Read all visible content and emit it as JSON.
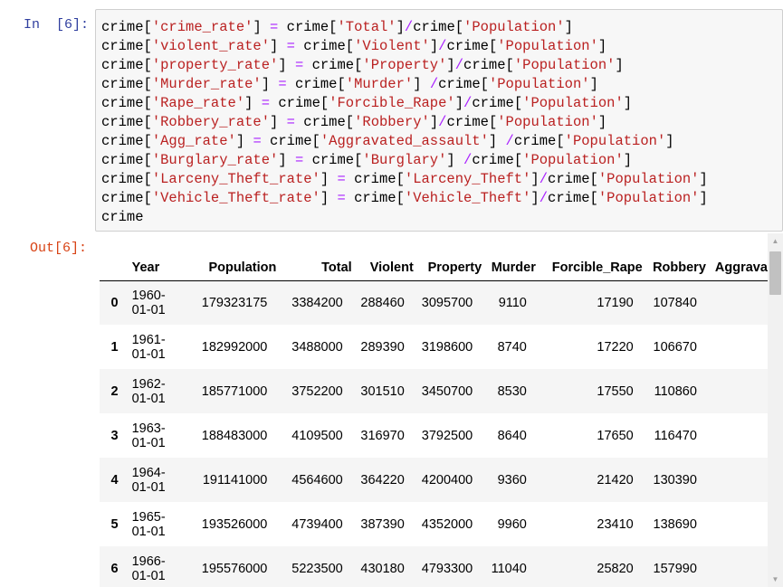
{
  "input_prompt": "In  [6]:",
  "output_prompt": "Out[6]:",
  "code_lines": [
    "crime['crime_rate'] = crime['Total']/crime['Population']",
    "crime['violent_rate'] = crime['Violent']/crime['Population']",
    "crime['property_rate'] = crime['Property']/crime['Population']",
    "crime['Murder_rate'] = crime['Murder'] /crime['Population']",
    "crime['Rape_rate'] = crime['Forcible_Rape']/crime['Population']",
    "crime['Robbery_rate'] = crime['Robbery']/crime['Population']",
    "crime['Agg_rate'] = crime['Aggravated_assault'] /crime['Population']",
    "crime['Burglary_rate'] = crime['Burglary'] /crime['Population']",
    "crime['Larceny_Theft_rate'] = crime['Larceny_Theft']/crime['Population']",
    "crime['Vehicle_Theft_rate'] = crime['Vehicle_Theft']/crime['Population']",
    "crime"
  ],
  "table": {
    "columns": [
      "",
      "Year",
      "Population",
      "Total",
      "Violent",
      "Property",
      "Murder",
      "Forcible_Rape",
      "Robbery",
      "Aggrava"
    ],
    "rows": [
      {
        "index": "0",
        "year_a": "1960-",
        "year_b": "01-01",
        "cells": [
          "179323175",
          "3384200",
          "288460",
          "3095700",
          "9110",
          "17190",
          "107840",
          ""
        ]
      },
      {
        "index": "1",
        "year_a": "1961-",
        "year_b": "01-01",
        "cells": [
          "182992000",
          "3488000",
          "289390",
          "3198600",
          "8740",
          "17220",
          "106670",
          ""
        ]
      },
      {
        "index": "2",
        "year_a": "1962-",
        "year_b": "01-01",
        "cells": [
          "185771000",
          "3752200",
          "301510",
          "3450700",
          "8530",
          "17550",
          "110860",
          ""
        ]
      },
      {
        "index": "3",
        "year_a": "1963-",
        "year_b": "01-01",
        "cells": [
          "188483000",
          "4109500",
          "316970",
          "3792500",
          "8640",
          "17650",
          "116470",
          ""
        ]
      },
      {
        "index": "4",
        "year_a": "1964-",
        "year_b": "01-01",
        "cells": [
          "191141000",
          "4564600",
          "364220",
          "4200400",
          "9360",
          "21420",
          "130390",
          ""
        ]
      },
      {
        "index": "5",
        "year_a": "1965-",
        "year_b": "01-01",
        "cells": [
          "193526000",
          "4739400",
          "387390",
          "4352000",
          "9960",
          "23410",
          "138690",
          ""
        ]
      },
      {
        "index": "6",
        "year_a": "1966-",
        "year_b": "01-01",
        "cells": [
          "195576000",
          "5223500",
          "430180",
          "4793300",
          "11040",
          "25820",
          "157990",
          ""
        ]
      }
    ]
  },
  "colors": {
    "string": "#ba2121",
    "operator": "#aa22ff",
    "in_prompt": "#303f9f",
    "out_prompt": "#d84315"
  }
}
